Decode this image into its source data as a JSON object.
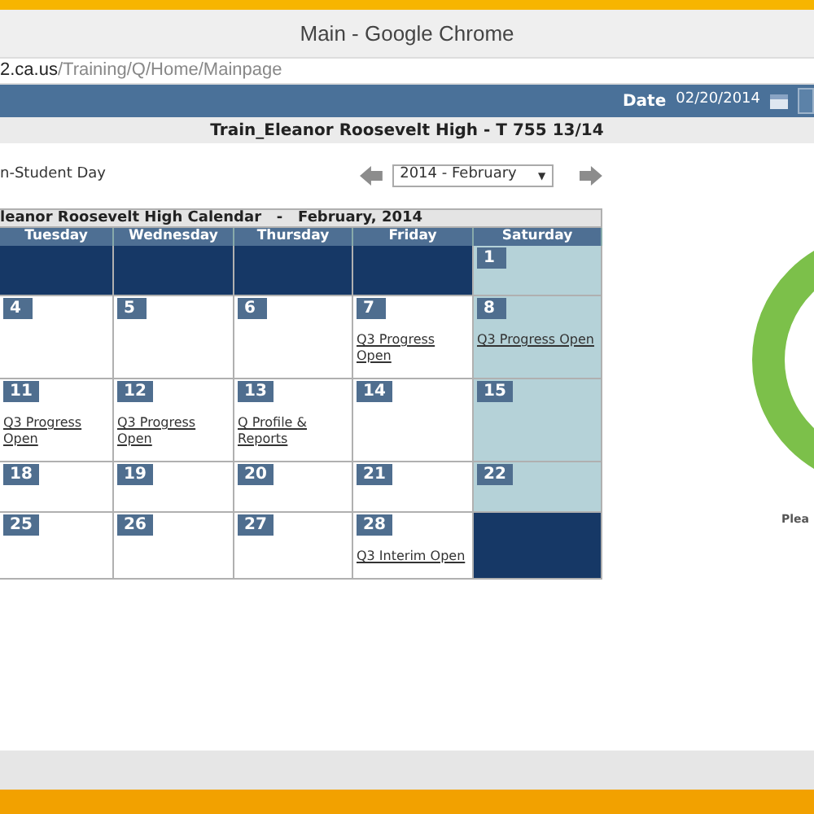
{
  "window": {
    "title": "Main - Google Chrome"
  },
  "address_bar": {
    "host": "2.ca.us",
    "path": "/Training/Q/Home/Mainpage"
  },
  "header": {
    "date_label": "Date",
    "date_value": "02/20/2014"
  },
  "school_title": "Train_Eleanor Roosevelt High - T 755 13/14",
  "legend_text": "n-Student Day",
  "month_select": {
    "value": "2014 - February",
    "caret": "▼"
  },
  "calendar": {
    "title": "leanor Roosevelt High Calendar   -   February, 2014",
    "columns": [
      "Tuesday",
      "Wednesday",
      "Thursday",
      "Friday",
      "Saturday"
    ],
    "weeks": [
      {
        "kind": "short",
        "cells": [
          {
            "kind": "outside"
          },
          {
            "kind": "outside"
          },
          {
            "kind": "outside"
          },
          {
            "kind": "outside"
          },
          {
            "kind": "weekend",
            "day": "1"
          }
        ]
      },
      {
        "kind": "tall",
        "cells": [
          {
            "kind": "weekday",
            "day": "4"
          },
          {
            "kind": "weekday",
            "day": "5"
          },
          {
            "kind": "weekday",
            "day": "6"
          },
          {
            "kind": "weekday",
            "day": "7",
            "event": "Q3 Progress Open"
          },
          {
            "kind": "weekend",
            "day": "8",
            "event": "Q3 Progress Open"
          }
        ]
      },
      {
        "kind": "tall",
        "cells": [
          {
            "kind": "weekday",
            "day": "11",
            "event": "Q3 Progress Open"
          },
          {
            "kind": "weekday",
            "day": "12",
            "event": "Q3 Progress Open"
          },
          {
            "kind": "weekday",
            "day": "13",
            "event": "Q Profile & Reports"
          },
          {
            "kind": "weekday",
            "day": "14"
          },
          {
            "kind": "weekend",
            "day": "15"
          }
        ]
      },
      {
        "kind": "short",
        "cells": [
          {
            "kind": "weekday",
            "day": "18"
          },
          {
            "kind": "weekday",
            "day": "19"
          },
          {
            "kind": "weekday",
            "day": "20"
          },
          {
            "kind": "weekday",
            "day": "21"
          },
          {
            "kind": "weekend",
            "day": "22"
          }
        ]
      },
      {
        "kind": "medium",
        "cells": [
          {
            "kind": "weekday",
            "day": "25"
          },
          {
            "kind": "weekday",
            "day": "26"
          },
          {
            "kind": "weekday",
            "day": "27"
          },
          {
            "kind": "weekday",
            "day": "28",
            "event": "Q3 Interim Open"
          },
          {
            "kind": "outside"
          }
        ]
      }
    ]
  },
  "side_panel": {
    "caption": "Plea"
  }
}
